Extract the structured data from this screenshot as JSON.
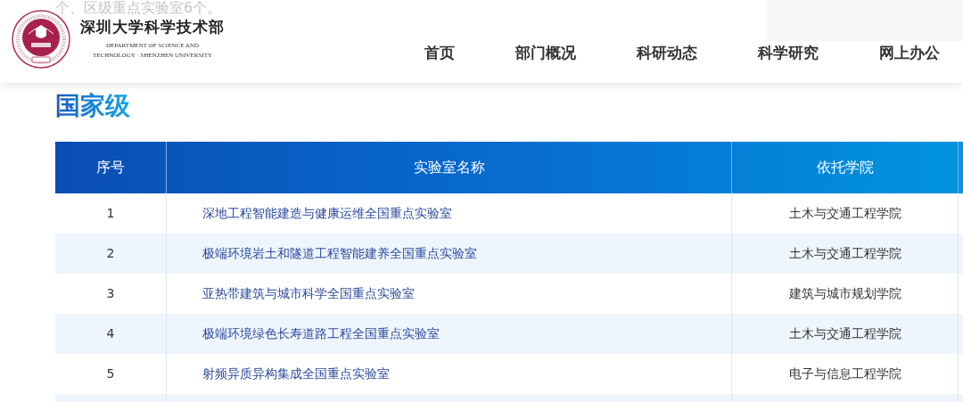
{
  "background_text": "个、区级重点实验室6个。",
  "header": {
    "title": "深圳大学科学技术部",
    "subtitle_line_1": "DEPARTMENT OF SCIENCE AND",
    "subtitle_line_2": "TECHNOLOGY · SHENZHEN UNIVERSITY",
    "nav": [
      "首页",
      "部门概况",
      "科研动态",
      "科学研究",
      "网上办公"
    ]
  },
  "section_title": "国家级",
  "table": {
    "columns": [
      "序号",
      "实验室名称",
      "依托学院"
    ],
    "rows": [
      {
        "number": "1",
        "name": "深地工程智能建造与健康运维全国重点实验室",
        "college": "土木与交通工程学院"
      },
      {
        "number": "2",
        "name": "极端环境岩土和隧道工程智能建养全国重点实验室",
        "college": "土木与交通工程学院"
      },
      {
        "number": "3",
        "name": "亚热带建筑与城市科学全国重点实验室",
        "college": "建筑与城市规划学院"
      },
      {
        "number": "4",
        "name": "极端环境绿色长寿道路工程全国重点实验室",
        "college": "土木与交通工程学院"
      },
      {
        "number": "5",
        "name": "射频异质异构集成全国重点实验室",
        "college": "电子与信息工程学院"
      }
    ]
  }
}
